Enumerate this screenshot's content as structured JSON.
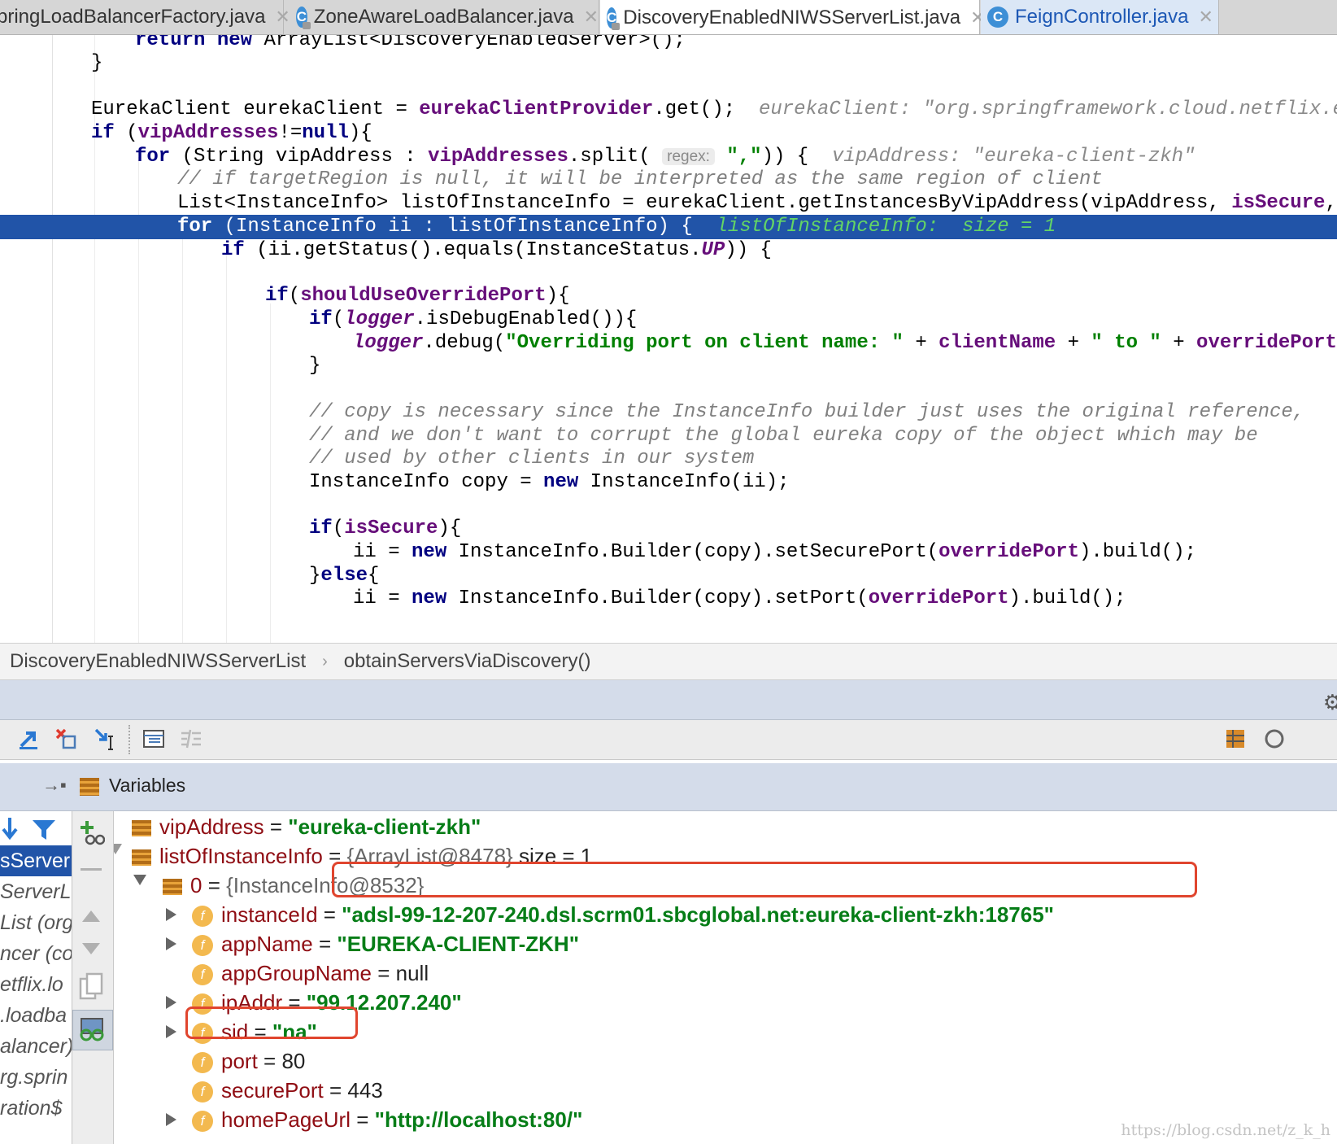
{
  "tabs": [
    {
      "label": "pringLoadBalancerFactory.java",
      "icon": "none",
      "active": false
    },
    {
      "label": "ZoneAwareLoadBalancer.java",
      "icon": "class-icon",
      "active": false
    },
    {
      "label": "DiscoveryEnabledNIWSServerList.java",
      "icon": "class-icon",
      "active": true
    },
    {
      "label": "FeignController.java",
      "icon": "class-icon",
      "active": false
    }
  ],
  "editor": {
    "line1": {
      "kw1": "return",
      "kw2": "new",
      "rest": "ArrayList<DiscoveryEnabledServer>();"
    },
    "line2": "}",
    "line4": {
      "a": "EurekaClient eurekaClient = ",
      "b": "eurekaClientProvider",
      "c": ".get();",
      "hint": "eurekaClient: \"org.springframework.cloud.netflix.eure"
    },
    "line5": {
      "kw": "if",
      "a": " (",
      "b": "vipAddresses",
      "c": "!=",
      "d": "null",
      "e": "){"
    },
    "line6": {
      "kw": "for",
      "a": " (String vipAddress : ",
      "b": "vipAddresses",
      "c": ".split(",
      "param": "regex:",
      "s": "\",\"",
      "d": ")) {",
      "hint": "vipAddress: \"eureka-client-zkh\""
    },
    "line7": "// if targetRegion is null, it will be interpreted as the same region of client",
    "line8": {
      "a": "List<InstanceInfo> listOfInstanceInfo = eurekaClient.getInstancesByVipAddress(vipAddress, ",
      "b": "isSecure",
      "c": ", ta"
    },
    "line9": {
      "kw": "for",
      "a": " (InstanceInfo ii : listOfInstanceInfo) {",
      "inline": "listOfInstanceInfo:  size = 1"
    },
    "line10": {
      "kw": "if",
      "a": " (ii.getStatus().equals(InstanceStatus.",
      "b": "UP",
      "c": ")) {"
    },
    "line12": {
      "kw": "if",
      "a": "(",
      "b": "shouldUseOverridePort",
      "c": "){"
    },
    "line13": {
      "kw": "if",
      "a": "(",
      "b": "logger",
      "c": ".isDebugEnabled()){"
    },
    "line14": {
      "a": "logger",
      "b": ".debug(",
      "s1": "\"Overriding port on client name: \"",
      "c": " + ",
      "d": "clientName",
      "e": " + ",
      "s2": "\" to \"",
      "f": " + ",
      "g": "overridePort",
      "h": ")"
    },
    "line15": "}",
    "line17": "// copy is necessary since the InstanceInfo builder just uses the original reference,",
    "line18": "// and we don't want to corrupt the global eureka copy of the object which may be",
    "line19": "// used by other clients in our system",
    "line20": {
      "a": "InstanceInfo copy = ",
      "kw": "new",
      "b": " InstanceInfo(ii);"
    },
    "line22": {
      "kw": "if",
      "a": "(",
      "b": "isSecure",
      "c": "){"
    },
    "line23": {
      "a": "ii = ",
      "kw": "new",
      "b": " InstanceInfo.Builder(copy).setSecurePort(",
      "c": "overridePort",
      "d": ").build();"
    },
    "line24": {
      "a": "}",
      "kw": "else",
      "b": "{"
    },
    "line25": {
      "a": "ii = ",
      "kw": "new",
      "b": " InstanceInfo.Builder(copy).setPort(",
      "c": "overridePort",
      "d": ").build();"
    }
  },
  "breadcrumb": {
    "class": "DiscoveryEnabledNIWSServerList",
    "separator": "›",
    "method": "obtainServersViaDiscovery()"
  },
  "debugger": {
    "variables_title": "Variables",
    "frames": [
      "sServer",
      "ServerL",
      "List (org",
      "ncer (co",
      "etflix.lo",
      ".loadba",
      "alancer)",
      "rg.sprin",
      "ration$"
    ],
    "variables": [
      {
        "name": "vipAddress",
        "eq": " = ",
        "value": "\"eureka-client-zkh\"",
        "kind": "str"
      },
      {
        "name": "listOfInstanceInfo",
        "eq": " = ",
        "value": "{ArrayList@8478}",
        "extra": "  size = 1",
        "kind": "obj"
      },
      {
        "name": "0",
        "eq": " = ",
        "value": "{InstanceInfo@8532}",
        "kind": "obj"
      },
      {
        "name": "instanceId",
        "eq": " = ",
        "value": "\"adsl-99-12-207-240.dsl.scrm01.sbcglobal.net:eureka-client-zkh:18765\"",
        "kind": "str"
      },
      {
        "name": "appName",
        "eq": " = ",
        "value": "\"EUREKA-CLIENT-ZKH\"",
        "kind": "str"
      },
      {
        "name": "appGroupName",
        "eq": " = ",
        "value": "null",
        "kind": "num"
      },
      {
        "name": "ipAddr",
        "eq": " = ",
        "value": "\"99.12.207.240\"",
        "kind": "str"
      },
      {
        "name": "sid",
        "eq": " = ",
        "value": "\"na\"",
        "kind": "str"
      },
      {
        "name": "port",
        "eq": " = ",
        "value": "80",
        "kind": "num"
      },
      {
        "name": "securePort",
        "eq": " = ",
        "value": "443",
        "kind": "num"
      },
      {
        "name": "homePageUrl",
        "eq": " = ",
        "value": "\"http://localhost:80/\"",
        "kind": "str"
      }
    ]
  },
  "watermark": "https://blog.csdn.net/z_k_h",
  "colors": {
    "highlight": "#2154a8",
    "keyword": "#000080",
    "field": "#660e7a",
    "string": "#008000",
    "annotation_box": "#e0452e"
  }
}
